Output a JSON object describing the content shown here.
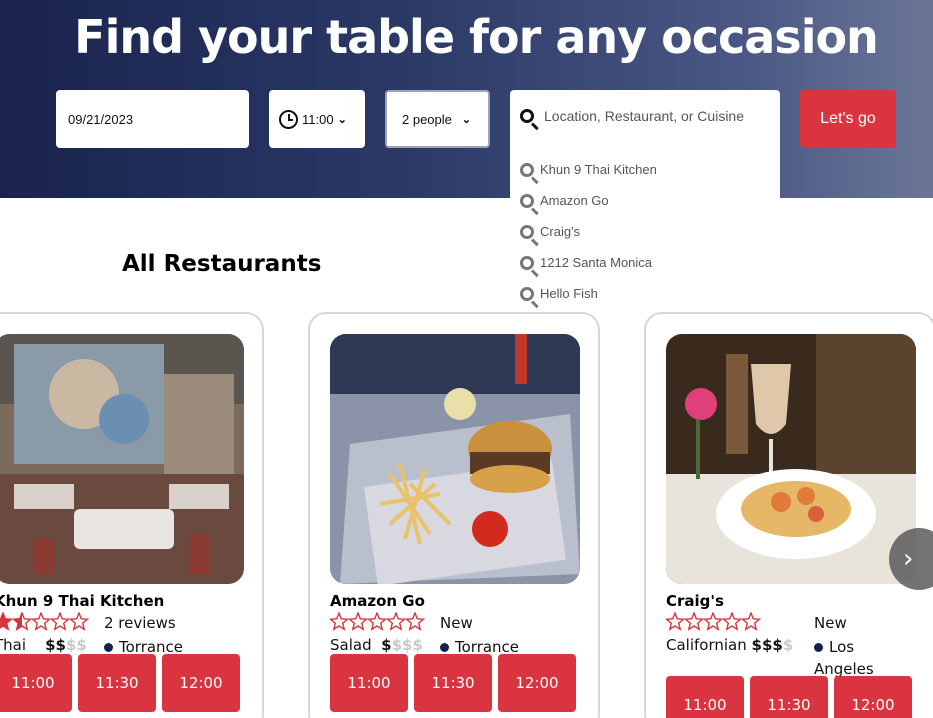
{
  "hero": {
    "title": "Find your table for any occasion",
    "date_value": "09/21/2023",
    "time_value": "11:00",
    "party_value": "2 people",
    "search_placeholder": "Location, Restaurant, or Cuisine",
    "go_label": "Let's go",
    "suggestions": [
      "Khun 9 Thai Kitchen",
      "Amazon Go",
      "Craig's",
      "1212 Santa Monica",
      "Hello Fish"
    ]
  },
  "section_title": "All Restaurants",
  "restaurants": [
    {
      "name": "Khun 9 Thai Kitchen",
      "rating": 1.5,
      "reviews": "2 reviews",
      "cuisine": "Thai",
      "price_level": "$$",
      "price_rest": "$$",
      "location": "Torrance",
      "times": [
        "11:00",
        "11:30",
        "12:00"
      ]
    },
    {
      "name": "Amazon Go",
      "rating": 0,
      "reviews": "New",
      "cuisine": "Salad",
      "price_level": "$",
      "price_rest": "$$$",
      "location": "Torrance",
      "times": [
        "11:00",
        "11:30",
        "12:00"
      ]
    },
    {
      "name": "Craig's",
      "rating": 0,
      "reviews": "New",
      "cuisine": "Californian",
      "price_level": "$$$",
      "price_rest": "$",
      "location": "Los Angeles",
      "times": [
        "11:00",
        "11:30",
        "12:00"
      ]
    }
  ],
  "colors": {
    "accent": "#d9343f",
    "hero_dark": "#19234d",
    "hero_light": "#6b7696"
  },
  "icons": {
    "time": "clock-icon",
    "search": "search-icon",
    "next": "chevron-right-icon"
  }
}
